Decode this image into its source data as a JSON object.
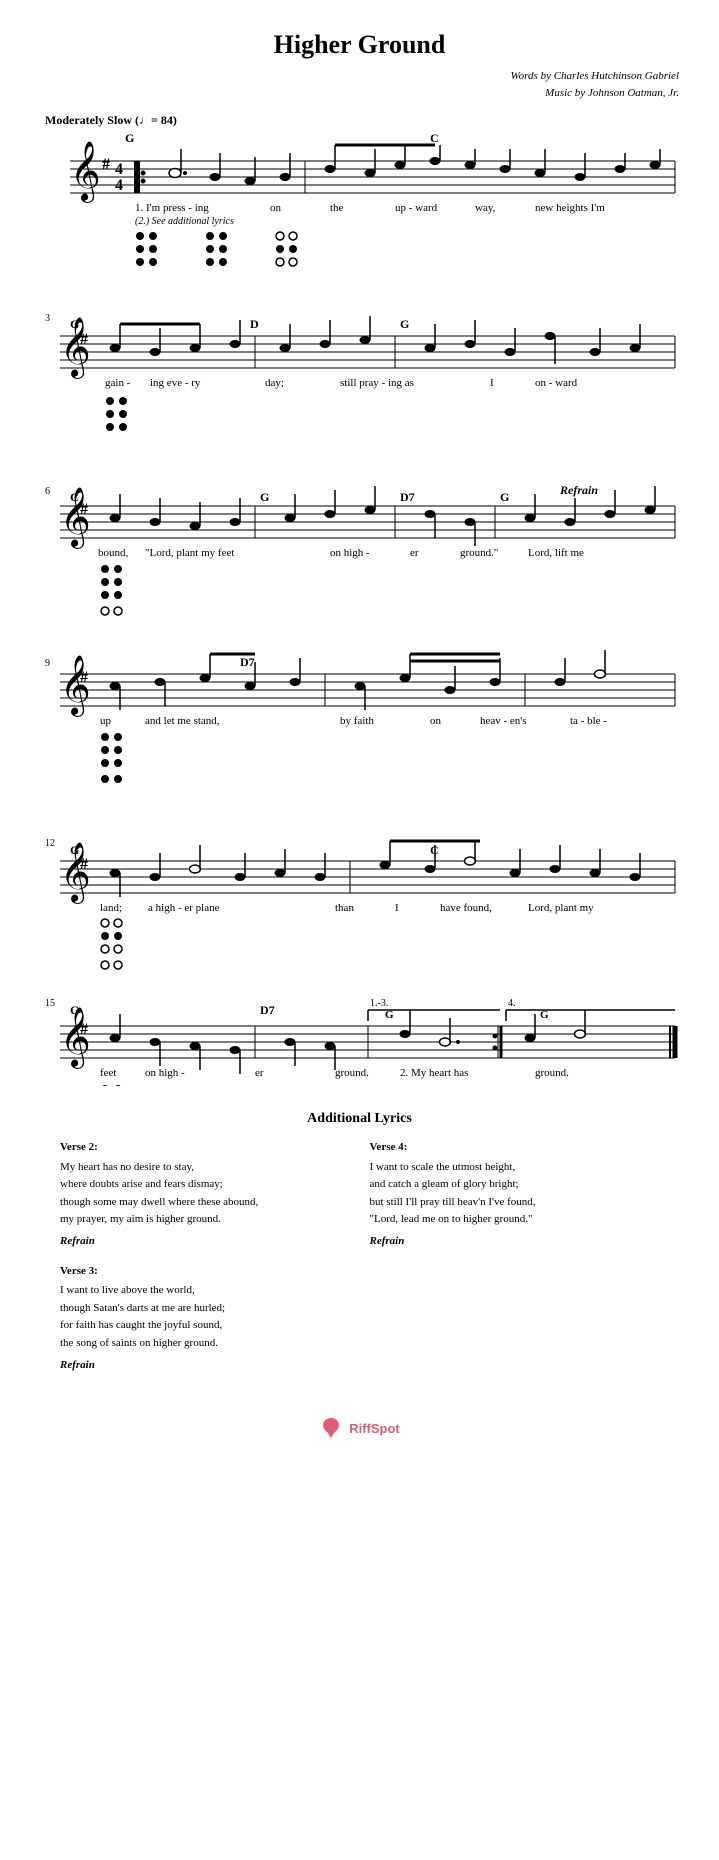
{
  "title": "Higher Ground",
  "attribution": {
    "line1": "Words by Charles Hutchinson Gabriel",
    "line2": "Music by Johnson Oatman, Jr."
  },
  "tempo": "Moderately Slow (♩= 84)",
  "additional_lyrics": {
    "heading": "Additional Lyrics",
    "verse2_title": "Verse 2:",
    "verse2_text": "My heart has no desire to stay,\nwhere doubts arise and fears dismay;\nthough some may dwell where these abound,\nmy prayer, my aim is higher ground.",
    "verse2_refrain": "Refrain",
    "verse3_title": "Verse 3:",
    "verse3_text": "I want to live above the world,\nthough Satan's darts at me are hurled;\nfor faith has caught the joyful sound,\nthe song of saints on higher ground.",
    "verse3_refrain": "Refrain",
    "verse4_title": "Verse 4:",
    "verse4_text": "I want to scale the utmost height,\nand catch a gleam of glory bright;\nbut still I'll pray till heav'n I've found,\n\"Lord, lead me on to higher ground.\"",
    "verse4_refrain": "Refrain"
  },
  "footer": {
    "logo_text": "RiffSpot"
  }
}
